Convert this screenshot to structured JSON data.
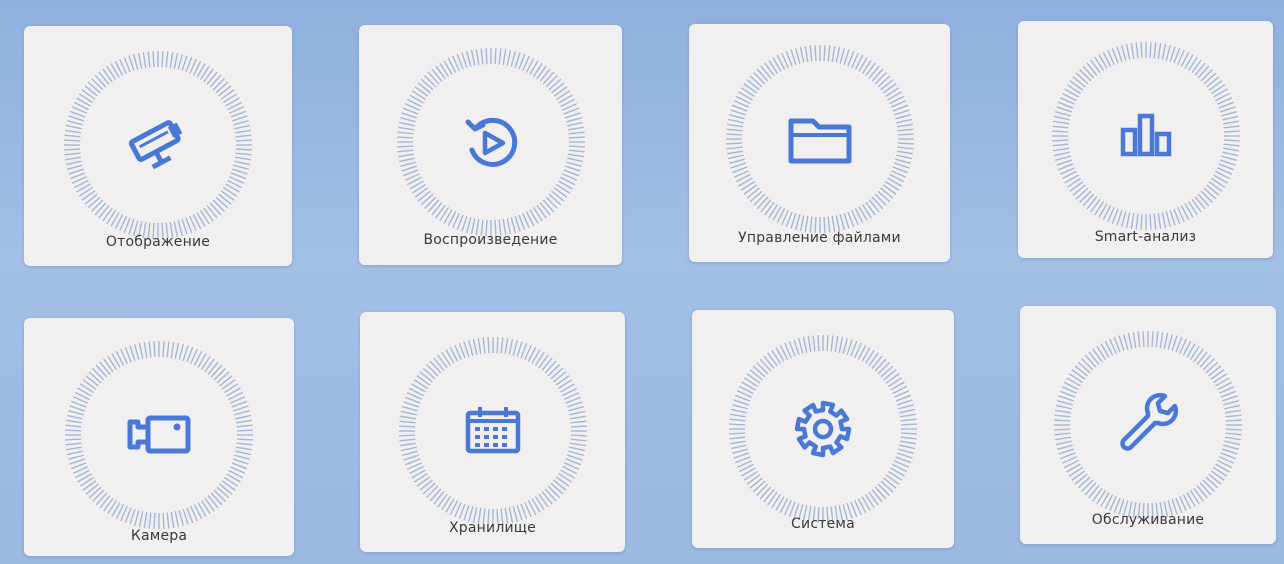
{
  "menu": {
    "items": [
      {
        "label": "Отображение",
        "icon": "cctv-camera-icon"
      },
      {
        "label": "Воспроизведение",
        "icon": "playback-icon"
      },
      {
        "label": "Управление файлами",
        "icon": "folder-icon"
      },
      {
        "label": "Smart-анализ",
        "icon": "bar-chart-icon"
      },
      {
        "label": "Камера",
        "icon": "camera-icon"
      },
      {
        "label": "Хранилище",
        "icon": "calendar-storage-icon"
      },
      {
        "label": "Система",
        "icon": "gear-icon"
      },
      {
        "label": "Обслуживание",
        "icon": "wrench-icon"
      }
    ]
  },
  "colors": {
    "icon": "#4a78d6",
    "ring": "#a6b7d6",
    "tile": "#f1efef",
    "background": "#9cb9e2",
    "label": "#3a3a3a"
  }
}
